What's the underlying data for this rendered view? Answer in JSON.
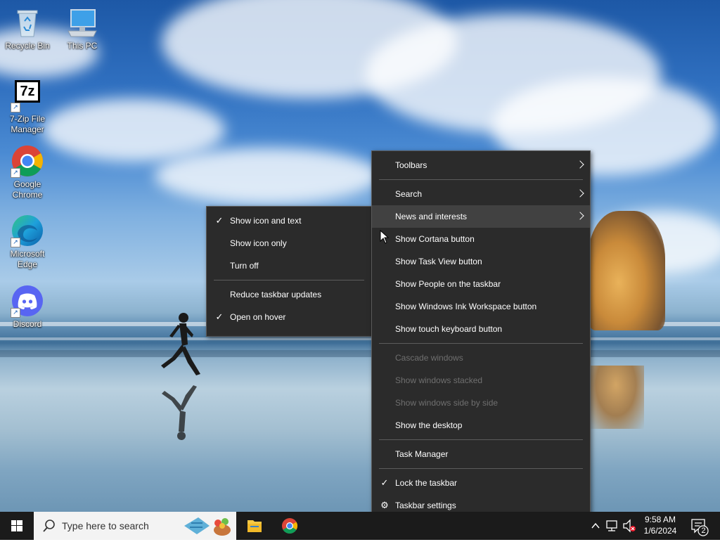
{
  "desktop": {
    "icons": [
      {
        "label": "Recycle Bin",
        "icon": "recycle-bin-icon"
      },
      {
        "label": "This PC",
        "icon": "this-pc-icon"
      },
      {
        "label_line1": "7-Zip File",
        "label_line2": "Manager",
        "icon": "7zip-icon",
        "glyph": "7z"
      },
      {
        "label_line1": "Google",
        "label_line2": "Chrome",
        "icon": "chrome-icon"
      },
      {
        "label_line1": "Microsoft",
        "label_line2": "Edge",
        "icon": "edge-icon"
      },
      {
        "label": "Discord",
        "icon": "discord-icon"
      }
    ]
  },
  "taskbar_menu": {
    "items": [
      {
        "label": "Toolbars",
        "submenu": true
      },
      {
        "label": "Search",
        "submenu": true
      },
      {
        "label": "News and interests",
        "submenu": true,
        "hover": true
      },
      {
        "label": "Show Cortana button"
      },
      {
        "label": "Show Task View button"
      },
      {
        "label": "Show People on the taskbar"
      },
      {
        "label": "Show Windows Ink Workspace button"
      },
      {
        "label": "Show touch keyboard button"
      },
      {
        "label": "Cascade windows",
        "disabled": true
      },
      {
        "label": "Show windows stacked",
        "disabled": true
      },
      {
        "label": "Show windows side by side",
        "disabled": true
      },
      {
        "label": "Show the desktop"
      },
      {
        "label": "Task Manager"
      },
      {
        "label": "Lock the taskbar",
        "checked": true
      },
      {
        "label": "Taskbar settings",
        "icon": "gear-icon"
      }
    ]
  },
  "news_submenu": {
    "items": [
      {
        "label": "Show icon and text",
        "checked": true
      },
      {
        "label": "Show icon only"
      },
      {
        "label": "Turn off"
      },
      {
        "label": "Reduce taskbar updates"
      },
      {
        "label": "Open on hover",
        "checked": true
      }
    ]
  },
  "taskbar": {
    "search_placeholder": "Type here to search",
    "time": "9:58 AM",
    "date": "1/6/2024",
    "notification_count": "2",
    "check_glyph": "✓",
    "gear_glyph": "⚙"
  },
  "colors": {
    "menu_bg": "#2b2b2b",
    "menu_hover": "#414141",
    "taskbar_bg": "#1b1b1b",
    "accent": "#0078d7"
  }
}
